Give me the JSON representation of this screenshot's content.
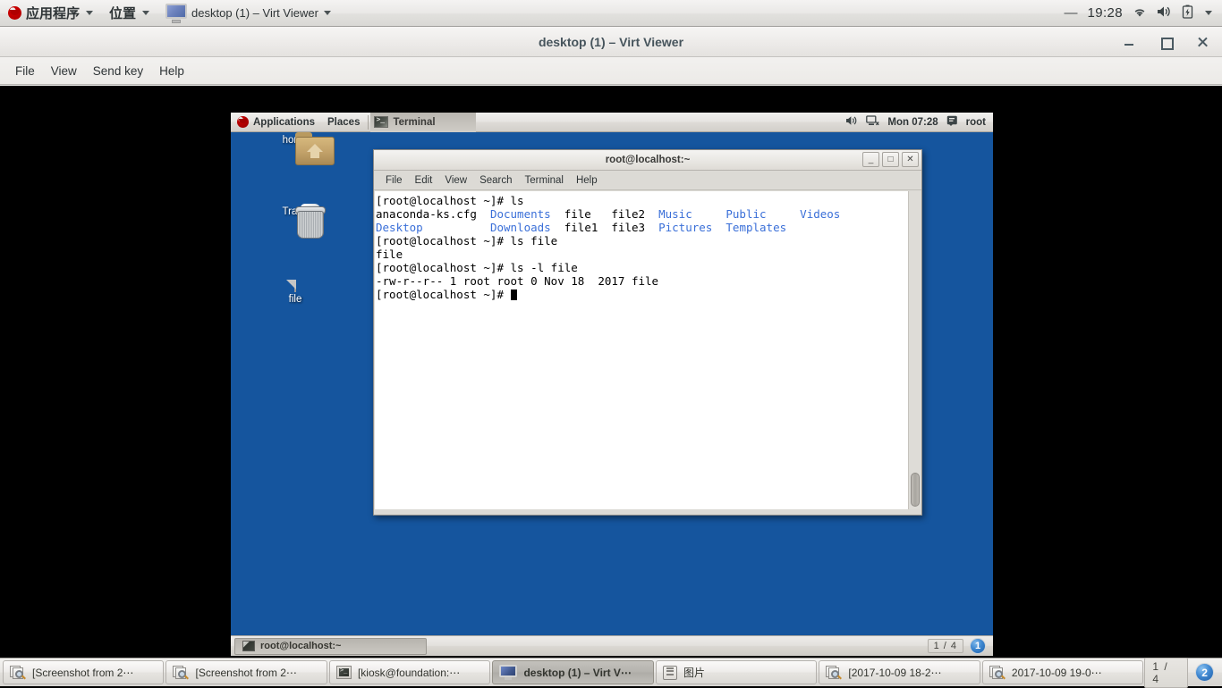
{
  "host_panel": {
    "apps_menu": "应用程序",
    "places_menu": "位置",
    "window_title": "desktop (1) – Virt Viewer",
    "dash": "—",
    "clock": "19:28",
    "icons": [
      "wifi-icon",
      "volume-icon",
      "battery-icon",
      "chevron-down-icon"
    ]
  },
  "virt_viewer": {
    "title": "desktop (1) – Virt Viewer",
    "menus": [
      "File",
      "View",
      "Send key",
      "Help"
    ],
    "controls": {
      "minimize": "minimize-button",
      "maximize": "maximize-button",
      "close": "close-button"
    }
  },
  "guest_panel": {
    "applications": "Applications",
    "places": "Places",
    "active_task": "Terminal",
    "clock": "Mon 07:28",
    "user": "root",
    "icons": [
      "volume-icon",
      "network-icon",
      "user-icon"
    ]
  },
  "desktop_icons": [
    {
      "label": "home",
      "icon": "home-folder-icon"
    },
    {
      "label": "Trash",
      "icon": "trash-icon"
    },
    {
      "label": "file",
      "icon": "file-document-icon"
    }
  ],
  "terminal": {
    "title": "root@localhost:~",
    "menus": [
      "File",
      "Edit",
      "View",
      "Search",
      "Terminal",
      "Help"
    ],
    "controls": {
      "minimize": "_",
      "maximize": "□",
      "close": "✕"
    },
    "lines": [
      {
        "segments": [
          {
            "text": "[root@localhost ~]# ls",
            "kind": "plain"
          }
        ]
      },
      {
        "segments": [
          {
            "text": "anaconda-ks.cfg  ",
            "kind": "plain"
          },
          {
            "text": "Documents",
            "kind": "dir"
          },
          {
            "text": "  file   file2  ",
            "kind": "plain"
          },
          {
            "text": "Music",
            "kind": "dir"
          },
          {
            "text": "     ",
            "kind": "plain"
          },
          {
            "text": "Public",
            "kind": "dir"
          },
          {
            "text": "     ",
            "kind": "plain"
          },
          {
            "text": "Videos",
            "kind": "dir"
          }
        ]
      },
      {
        "segments": [
          {
            "text": "Desktop",
            "kind": "dir"
          },
          {
            "text": "          ",
            "kind": "plain"
          },
          {
            "text": "Downloads",
            "kind": "dir"
          },
          {
            "text": "  file1  file3  ",
            "kind": "plain"
          },
          {
            "text": "Pictures",
            "kind": "dir"
          },
          {
            "text": "  ",
            "kind": "plain"
          },
          {
            "text": "Templates",
            "kind": "dir"
          }
        ]
      },
      {
        "segments": [
          {
            "text": "[root@localhost ~]# ls file",
            "kind": "plain"
          }
        ]
      },
      {
        "segments": [
          {
            "text": "file",
            "kind": "plain"
          }
        ]
      },
      {
        "segments": [
          {
            "text": "[root@localhost ~]# ls -l file",
            "kind": "plain"
          }
        ]
      },
      {
        "segments": [
          {
            "text": "-rw-r--r-- 1 root root 0 Nov 18  2017 file",
            "kind": "plain"
          }
        ]
      },
      {
        "segments": [
          {
            "text": "[root@localhost ~]# ",
            "kind": "plain"
          },
          {
            "text": "",
            "kind": "cursor"
          }
        ]
      }
    ]
  },
  "guest_taskbar": {
    "tasks": [
      {
        "label": "root@localhost:~",
        "icon": "terminal-icon"
      }
    ],
    "workspace_count": "1 / 4",
    "workspace_current": "1"
  },
  "host_taskbar": {
    "tasks": [
      {
        "label": "[Screenshot from 2⋯",
        "icon": "screenshot-icon",
        "active": false
      },
      {
        "label": "[Screenshot from 2⋯",
        "icon": "screenshot-icon",
        "active": false
      },
      {
        "label": "[kiosk@foundation:⋯",
        "icon": "terminal-icon",
        "active": false
      },
      {
        "label": "desktop (1) – Virt V⋯",
        "icon": "monitor-icon",
        "active": true
      },
      {
        "label": "图片",
        "icon": "archive-icon",
        "active": false
      },
      {
        "label": "[2017-10-09 18-2⋯",
        "icon": "screenshot-icon",
        "active": false
      },
      {
        "label": "2017-10-09 19-0⋯",
        "icon": "screenshot-icon",
        "active": false
      }
    ],
    "workspace_count": "1 / 4",
    "workspace_current": "2"
  },
  "colors": {
    "desktop_blue": "#15559e",
    "terminal_dir_blue": "#3a6fd8",
    "panel_grey": "#e6e4e1",
    "badge_blue": "#3d87d0"
  }
}
